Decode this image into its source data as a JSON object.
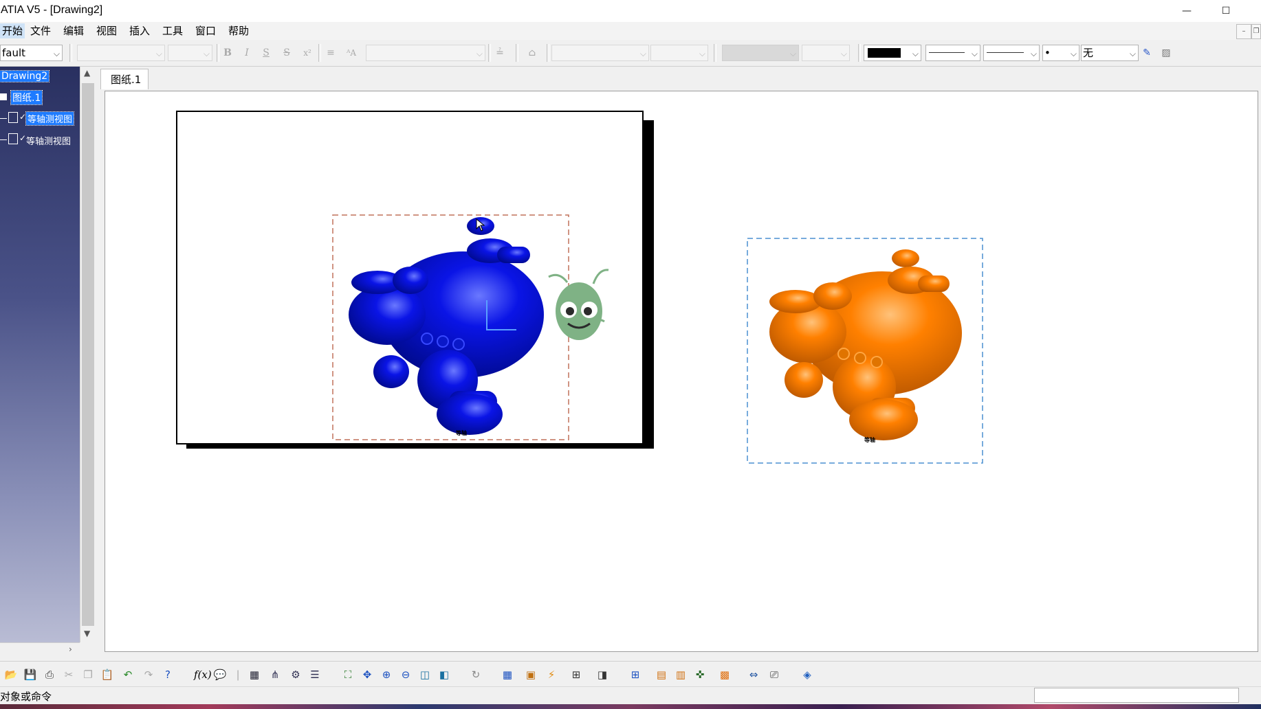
{
  "window": {
    "title": "ATIA V5 - [Drawing2]",
    "minimize_glyph": "—",
    "maximize_glyph": "☐"
  },
  "menu": {
    "items": [
      "开始",
      "文件",
      "编辑",
      "视图",
      "插入",
      "工具",
      "窗口",
      "帮助"
    ],
    "active": "开始",
    "mdi_minimize": "–",
    "mdi_restore": "❐"
  },
  "format_toolbar": {
    "style_value": "fault",
    "bold": "B",
    "italic": "I",
    "underline": "S",
    "strike": "S",
    "superscript": "x²",
    "fill_color": "#000000",
    "point_value": "•",
    "pattern_value": "无"
  },
  "tree": {
    "root": "Drawing2",
    "sheet": "图纸.1",
    "views": [
      "等轴测视图",
      "等轴测视图"
    ]
  },
  "sheet_tab": "图纸.1",
  "drawing": {
    "view1_color": "#0a14e6",
    "view1_frame_color": "#c0705a",
    "view2_color": "#ff8000",
    "view2_frame_color": "#4a8fd0",
    "view1_label": "等轴",
    "view2_label": "等轴",
    "mascot_color": "#7fb285"
  },
  "bottom_toolbar": {
    "icons": [
      "open-icon",
      "save-icon",
      "print-icon",
      "cut-icon",
      "copy-icon",
      "paste-icon",
      "undo-icon",
      "redo-icon",
      "whats-this-icon",
      "formula-icon",
      "comment-icon",
      "knowledge-icon",
      "table-icon",
      "tree-icon",
      "measure-icon",
      "analysis-icon",
      "fit-all-icon",
      "pan-icon",
      "zoom-in-icon",
      "zoom-out-icon",
      "normal-view-icon",
      "multi-view-icon",
      "refresh-icon",
      "grid-icon",
      "sheet-icon",
      "generate-icon",
      "layout-icon",
      "frame-icon",
      "grid2-icon",
      "view-icon",
      "dimension-icon",
      "annotation-icon",
      "print-area-icon",
      "compare-icon",
      "part-icon"
    ]
  },
  "status": {
    "prompt": "对象或命令"
  }
}
